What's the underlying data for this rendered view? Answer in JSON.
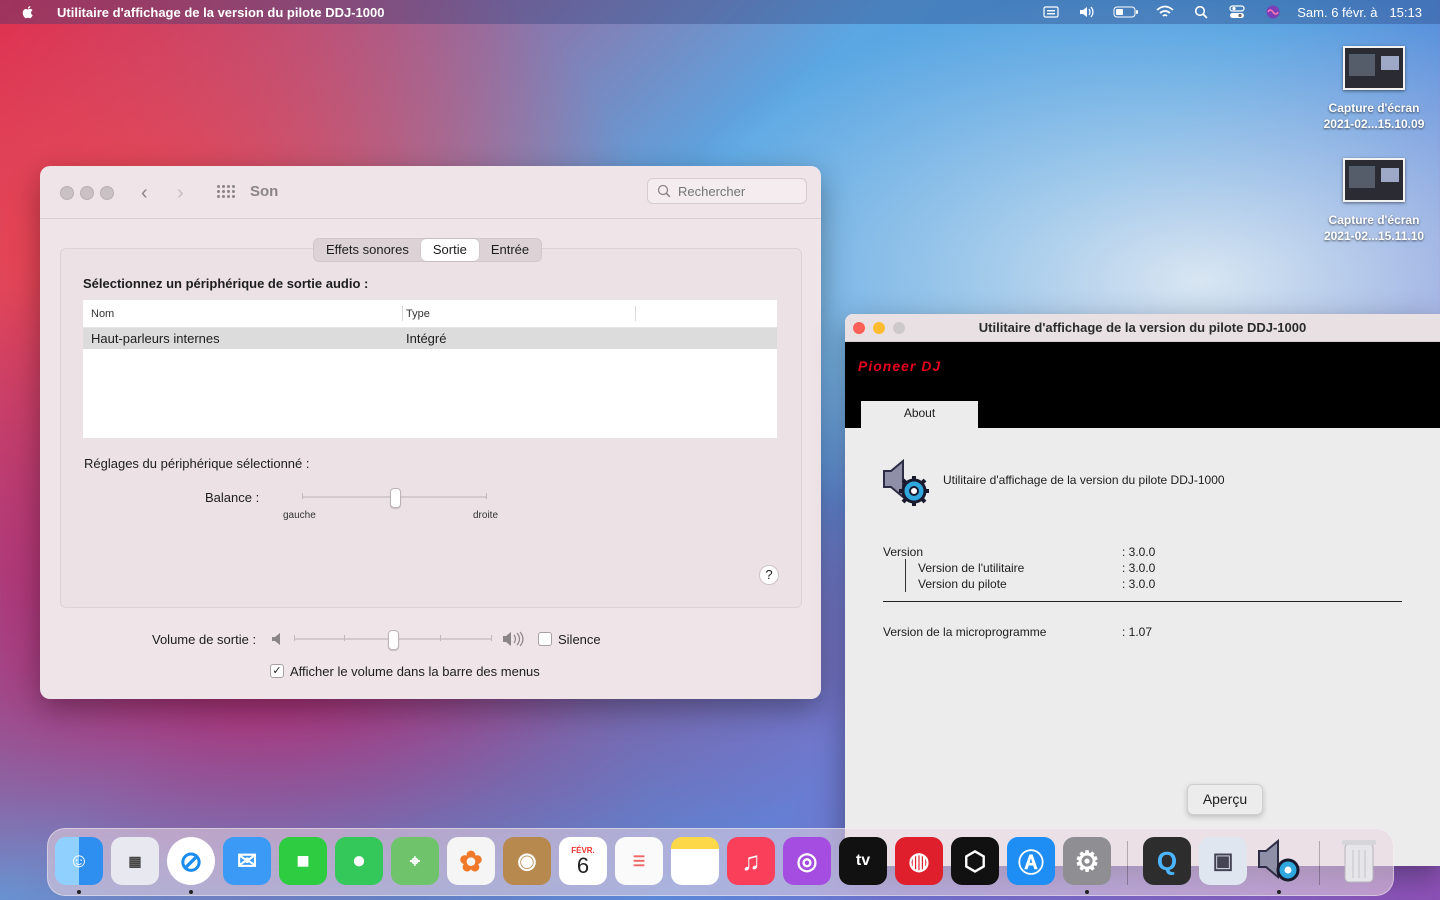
{
  "menubar": {
    "app_title": "Utilitaire d'affichage de la version du pilote DDJ-1000",
    "date": "Sam. 6 févr. à",
    "time": "15:13",
    "icons": [
      "apple-icon",
      "keyboard-input-icon",
      "volume-icon",
      "battery-icon",
      "wifi-icon",
      "spotlight-search-icon",
      "control-center-icon",
      "siri-icon"
    ]
  },
  "desktop": {
    "items": [
      {
        "name": "Capture d'écran",
        "date": "2021-02...15.10.09"
      },
      {
        "name": "Capture d'écran",
        "date": "2021-02...15.11.10"
      }
    ]
  },
  "son": {
    "title": "Son",
    "search_placeholder": "Rechercher",
    "tabs": [
      {
        "label": "Effets sonores",
        "active": false
      },
      {
        "label": "Sortie",
        "active": true
      },
      {
        "label": "Entrée",
        "active": false
      }
    ],
    "heading": "Sélectionnez un périphérique de sortie audio :",
    "table": {
      "columns": [
        "Nom",
        "Type"
      ],
      "rows": [
        {
          "nom": "Haut-parleurs internes",
          "type": "Intégré",
          "selected": true
        }
      ]
    },
    "reglages": "Réglages du périphérique sélectionné :",
    "balance": {
      "label": "Balance :",
      "left": "gauche",
      "right": "droite",
      "value": 0.5
    },
    "help": "?",
    "volume": {
      "label": "Volume de sortie :",
      "value": 0.5,
      "mute_label": "Silence",
      "mute_checked": false
    },
    "show_volume": {
      "label": "Afficher le volume dans la barre des menus",
      "checked": true
    }
  },
  "ddj": {
    "title": "Utilitaire d'affichage de la version du pilote DDJ-1000",
    "brand": "Pioneer DJ",
    "tab": "About",
    "app_name": "Utilitaire d'affichage de la version du pilote DDJ-1000",
    "version_label": "Version",
    "version_value": ": 3.0.0",
    "utility_label": "Version de l'utilitaire",
    "utility_value": ": 3.0.0",
    "driver_label": "Version du pilote",
    "driver_value": ": 3.0.0",
    "firmware_label": "Version de la  microprogramme",
    "firmware_value": ": 1.07"
  },
  "tooltip": "Aperçu",
  "dock": {
    "apps": [
      {
        "name": "Finder",
        "color": "#2f8ff0",
        "running": true
      },
      {
        "name": "Launchpad",
        "color": "#e8e8f0",
        "running": false
      },
      {
        "name": "Safari",
        "color": "#1a8cf0",
        "running": true
      },
      {
        "name": "Mail",
        "color": "#3b9af5",
        "running": false
      },
      {
        "name": "FaceTime",
        "color": "#2ecc40",
        "running": false
      },
      {
        "name": "Messages",
        "color": "#34c759",
        "running": false
      },
      {
        "name": "Plans",
        "color": "#6fc36a",
        "running": false
      },
      {
        "name": "Photos",
        "color": "#f5f5f5",
        "running": false
      },
      {
        "name": "Contacts",
        "color": "#b8894f",
        "running": false
      },
      {
        "name": "Calendrier",
        "color": "#ffffff",
        "running": false,
        "month": "FÉVR.",
        "day": "6"
      },
      {
        "name": "Rappels",
        "color": "#fafafa",
        "running": false
      },
      {
        "name": "Notes",
        "color": "#fde58a",
        "running": false
      },
      {
        "name": "Musique",
        "color": "#fa3f5b",
        "running": false
      },
      {
        "name": "Podcasts",
        "color": "#a54de0",
        "running": false
      },
      {
        "name": "TV",
        "color": "#111111",
        "running": false,
        "label": "tv"
      },
      {
        "name": "rekordbox",
        "color": "#e01f2d",
        "running": false
      },
      {
        "name": "Serato",
        "color": "#111111",
        "running": false
      },
      {
        "name": "App Store",
        "color": "#1e8ef5",
        "running": false
      },
      {
        "name": "Préférences Système",
        "color": "#8e8e93",
        "running": true
      },
      {
        "name": "QuickTime",
        "color": "#2d2d2d",
        "running": false
      },
      {
        "name": "Aperçu",
        "color": "#dfe6ef",
        "running": false
      },
      {
        "name": "DDJ-1000 Utility",
        "color": "transparent",
        "running": true
      },
      {
        "name": "Corbeille",
        "color": "transparent",
        "running": false
      }
    ]
  }
}
